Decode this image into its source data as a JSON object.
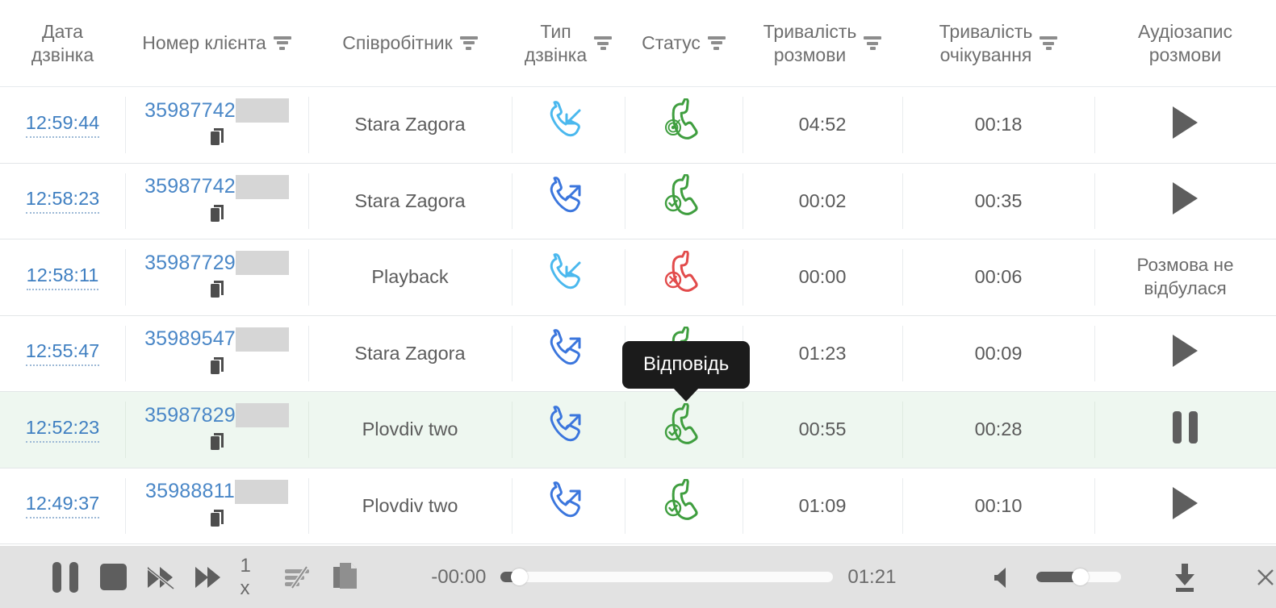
{
  "table": {
    "columns": [
      {
        "key": "date",
        "label": "Дата\nдзвінка",
        "filter": false
      },
      {
        "key": "num",
        "label": "Номер клієнта",
        "filter": true
      },
      {
        "key": "emp",
        "label": "Співробітник",
        "filter": true
      },
      {
        "key": "type",
        "label": "Тип\nдзвінка",
        "filter": true
      },
      {
        "key": "stat",
        "label": "Статус",
        "filter": true
      },
      {
        "key": "dur",
        "label": "Тривалість\nрозмови",
        "filter": true
      },
      {
        "key": "wait",
        "label": "Тривалість\nочікування",
        "filter": true
      },
      {
        "key": "audio",
        "label": "Аудіозапис\nрозмови",
        "filter": false
      }
    ],
    "rows": [
      {
        "date": "12:59:44",
        "phone": "35987742",
        "employee": "Stara Zagora",
        "call_type": "incoming",
        "status": "answered-dialing",
        "duration": "04:52",
        "wait": "00:18",
        "audio": "play",
        "highlight": false
      },
      {
        "date": "12:58:23",
        "phone": "35987742",
        "employee": "Stara Zagora",
        "call_type": "outgoing",
        "status": "answered",
        "duration": "00:02",
        "wait": "00:35",
        "audio": "play",
        "highlight": false
      },
      {
        "date": "12:58:11",
        "phone": "35987729",
        "employee": "Playback",
        "call_type": "incoming",
        "status": "missed",
        "duration": "00:00",
        "wait": "00:06",
        "audio": "text",
        "audio_text": "Розмова не\nвідбулася",
        "highlight": false
      },
      {
        "date": "12:55:47",
        "phone": "35989547",
        "employee": "Stara Zagora",
        "call_type": "outgoing",
        "status": "answered",
        "duration": "01:23",
        "wait": "00:09",
        "audio": "play",
        "highlight": false
      },
      {
        "date": "12:52:23",
        "phone": "35987829",
        "employee": "Plovdiv two",
        "call_type": "outgoing",
        "status": "answered",
        "duration": "00:55",
        "wait": "00:28",
        "audio": "pause",
        "highlight": true
      },
      {
        "date": "12:49:37",
        "phone": "35988811",
        "employee": "Plovdiv two",
        "call_type": "outgoing",
        "status": "answered",
        "duration": "01:09",
        "wait": "00:10",
        "audio": "play",
        "highlight": false
      }
    ]
  },
  "tooltip": {
    "text": "Відповідь"
  },
  "player": {
    "pause_label": "pause-icon",
    "stop_label": "stop-icon",
    "rewind_label": "rewind-disabled-icon",
    "forward_label": "fast-forward-icon",
    "speed": "1 x",
    "equalizer_label": "equalizer-off-icon",
    "copy_label": "copy-icon",
    "current_time": "-00:00",
    "total_time": "01:21",
    "progress_percent": 5,
    "volume_percent": 50,
    "download_label": "download-icon",
    "close_label": "close-icon"
  },
  "colors": {
    "link_blue": "#4a87c7",
    "incoming_blue": "#4ab8ee",
    "outgoing_blue": "#3b76dd",
    "status_green": "#3f9e3f",
    "status_red": "#e24b4b",
    "row_highlight": "#eef7f0",
    "player_bg": "#e2e2e2",
    "tooltip_bg": "#1b1b1b",
    "redaction_gray": "#d6d6d6"
  }
}
